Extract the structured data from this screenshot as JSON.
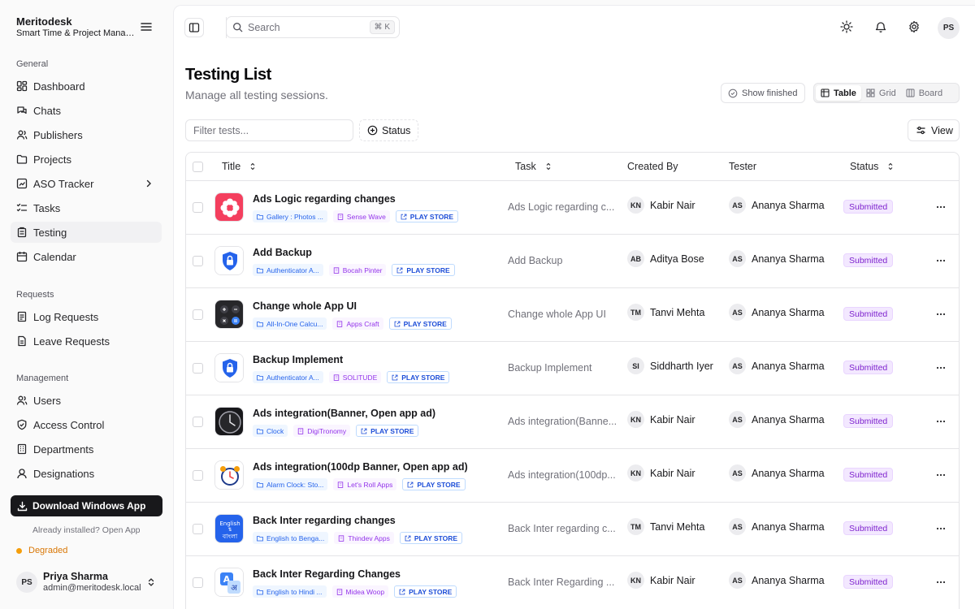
{
  "brand": {
    "name": "Meritodesk",
    "subtitle": "Smart Time & Project Manag..."
  },
  "sidebar": {
    "general_label": "General",
    "general": [
      "Dashboard",
      "Chats",
      "Publishers",
      "Projects",
      "ASO Tracker",
      "Tasks",
      "Testing",
      "Calendar"
    ],
    "requests_label": "Requests",
    "requests": [
      "Log Requests",
      "Leave Requests"
    ],
    "management_label": "Management",
    "management": [
      "Users",
      "Access Control",
      "Departments",
      "Designations"
    ],
    "download_label": "Download Windows App",
    "installed_text": "Already installed? Open App",
    "health_status": "Degraded",
    "health_color": "#f59e0b",
    "user": {
      "initials": "PS",
      "name": "Priya Sharma",
      "email": "admin@meritodesk.local"
    }
  },
  "topbar": {
    "search_placeholder": "Search",
    "search_shortcut": "⌘ K",
    "avatar_initials": "PS"
  },
  "page": {
    "title": "Testing List",
    "subtitle": "Manage all testing sessions.",
    "show_finished_label": "Show finished",
    "views": [
      "Table",
      "Grid",
      "Board"
    ],
    "active_view": "Table",
    "filter_placeholder": "Filter tests...",
    "status_filter_label": "Status",
    "view_button_label": "View"
  },
  "table": {
    "columns": {
      "title": "Title",
      "task": "Task",
      "created_by": "Created By",
      "tester": "Tester",
      "status": "Status"
    },
    "rows": [
      {
        "title": "Ads Logic regarding changes",
        "app": "Gallery : Photos ...",
        "publisher": "Sense Wave",
        "store": "PLAY STORE",
        "task": "Ads Logic regarding c...",
        "creator_initials": "KN",
        "creator": "Kabir Nair",
        "tester_initials": "AS",
        "tester": "Ananya Sharma",
        "status": "Submitted",
        "icon": "flower-icon"
      },
      {
        "title": "Add Backup",
        "app": "Authenticator A...",
        "publisher": "Bocah Pinter",
        "store": "PLAY STORE",
        "task": "Add Backup",
        "creator_initials": "AB",
        "creator": "Aditya Bose",
        "tester_initials": "AS",
        "tester": "Ananya Sharma",
        "status": "Submitted",
        "icon": "shield-lock-icon"
      },
      {
        "title": "Change whole App UI",
        "app": "All-In-One Calcu...",
        "publisher": "Apps Craft",
        "store": "PLAY STORE",
        "task": "Change whole App UI",
        "creator_initials": "TM",
        "creator": "Tanvi Mehta",
        "tester_initials": "AS",
        "tester": "Ananya Sharma",
        "status": "Submitted",
        "icon": "calculator-icon"
      },
      {
        "title": "Backup Implement",
        "app": "Authenticator A...",
        "publisher": "SOLITUDE",
        "store": "PLAY STORE",
        "task": "Backup Implement",
        "creator_initials": "SI",
        "creator": "Siddharth Iyer",
        "tester_initials": "AS",
        "tester": "Ananya Sharma",
        "status": "Submitted",
        "icon": "shield-lock-icon"
      },
      {
        "title": "Ads integration(Banner, Open app ad)",
        "app": "Clock",
        "publisher": "DigiTronomy",
        "store": "PLAY STORE",
        "task": "Ads integration(Banne...",
        "creator_initials": "KN",
        "creator": "Kabir Nair",
        "tester_initials": "AS",
        "tester": "Ananya Sharma",
        "status": "Submitted",
        "icon": "clock-icon"
      },
      {
        "title": "Ads integration(100dp Banner, Open app ad)",
        "app": "Alarm Clock: Sto...",
        "publisher": "Let's Roll Apps",
        "store": "PLAY STORE",
        "task": "Ads integration(100dp...",
        "creator_initials": "KN",
        "creator": "Kabir Nair",
        "tester_initials": "AS",
        "tester": "Ananya Sharma",
        "status": "Submitted",
        "icon": "alarm-clock-icon"
      },
      {
        "title": "Back Inter regarding changes",
        "app": "English to Benga...",
        "publisher": "Thindev Apps",
        "store": "PLAY STORE",
        "task": "Back Inter regarding c...",
        "creator_initials": "TM",
        "creator": "Tanvi Mehta",
        "tester_initials": "AS",
        "tester": "Ananya Sharma",
        "status": "Submitted",
        "icon": "translate-bengali-icon"
      },
      {
        "title": "Back Inter Regarding Changes",
        "app": "English to Hindi ...",
        "publisher": "Midea Woop",
        "store": "PLAY STORE",
        "task": "Back Inter Regarding ...",
        "creator_initials": "KN",
        "creator": "Kabir Nair",
        "tester_initials": "AS",
        "tester": "Ananya Sharma",
        "status": "Submitted",
        "icon": "translate-hindi-icon"
      }
    ]
  },
  "colors": {
    "accent": "#18181b",
    "status_badge": "#7e22ce",
    "chip_app": "#2563eb",
    "chip_publisher": "#9333ea"
  }
}
